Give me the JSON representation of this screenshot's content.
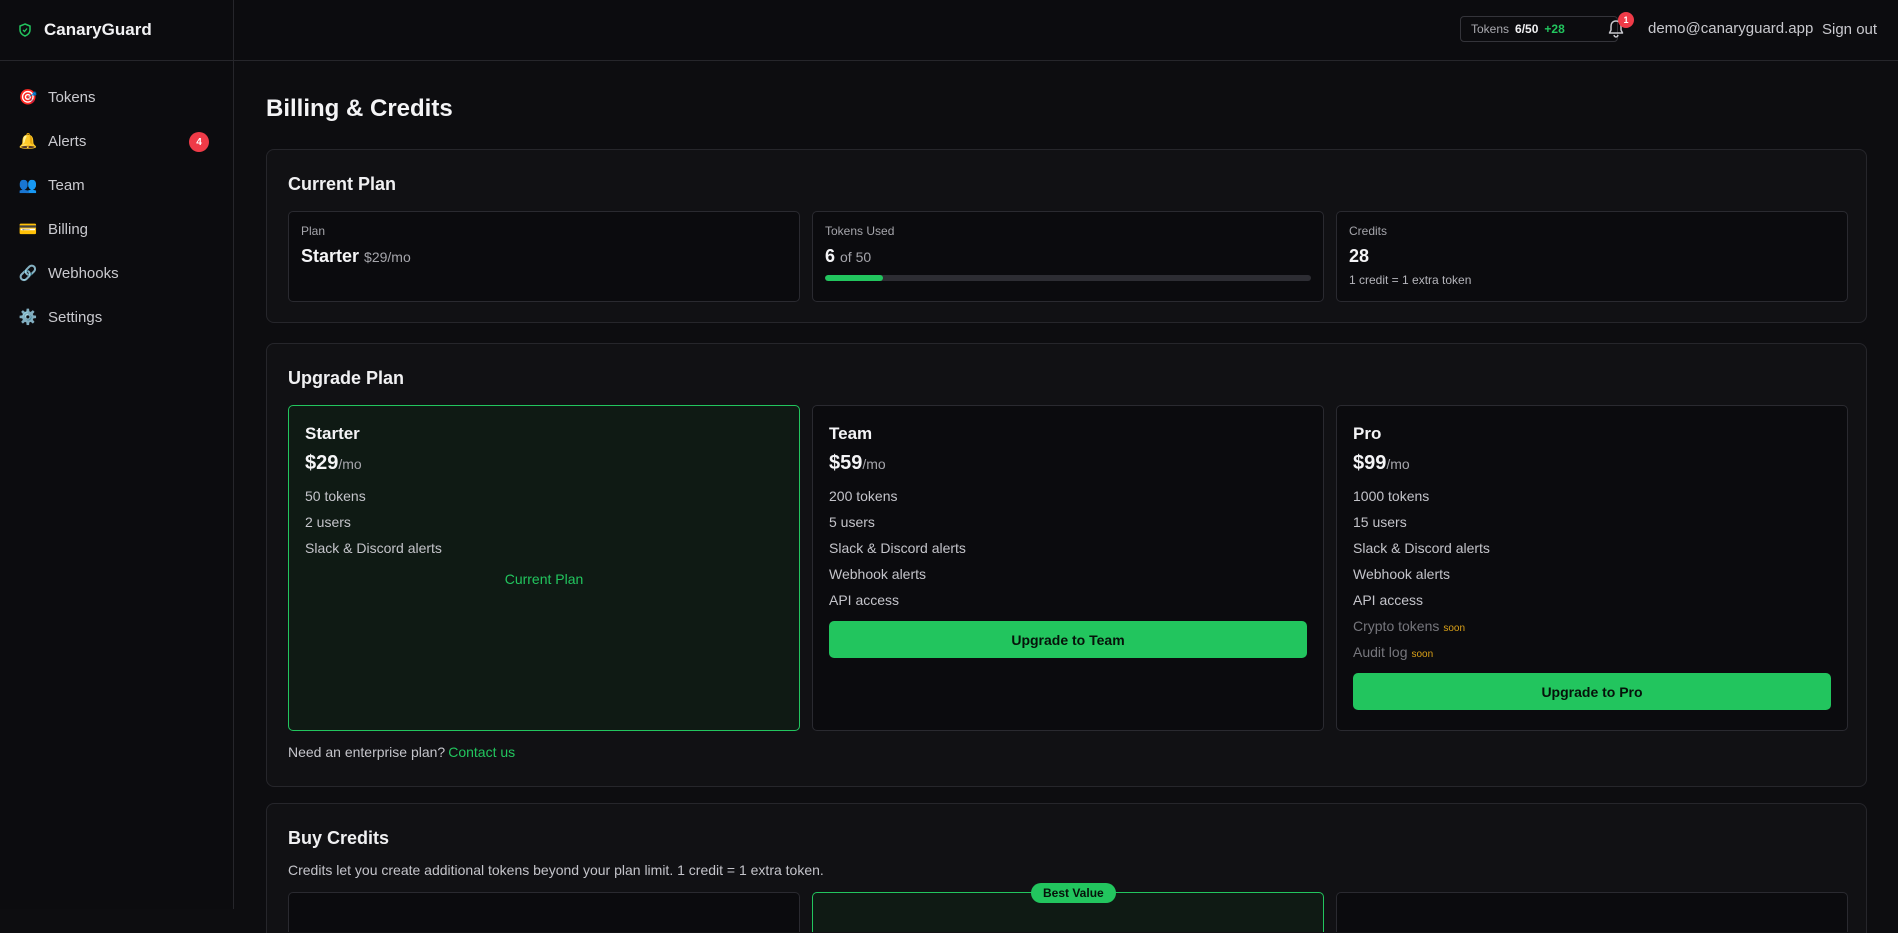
{
  "app": {
    "name": "CanaryGuard"
  },
  "sidebar": {
    "items": [
      {
        "icon": "🎯",
        "label": "Tokens"
      },
      {
        "icon": "🔔",
        "label": "Alerts",
        "badge": "4"
      },
      {
        "icon": "👥",
        "label": "Team"
      },
      {
        "icon": "💳",
        "label": "Billing"
      },
      {
        "icon": "🔗",
        "label": "Webhooks"
      },
      {
        "icon": "⚙️",
        "label": "Settings"
      }
    ]
  },
  "topbar": {
    "tokens_label": "Tokens",
    "tokens_count": "6/50",
    "tokens_extra": "+28",
    "notif_count": "1",
    "email": "demo@canaryguard.app",
    "signout": "Sign out"
  },
  "page": {
    "title": "Billing & Credits"
  },
  "current_plan": {
    "title": "Current Plan",
    "plan": {
      "label": "Plan",
      "value": "Starter",
      "price": "$29/mo"
    },
    "usage": {
      "label": "Tokens Used",
      "value": "6",
      "of": "of 50",
      "progress": 0.12
    },
    "credits": {
      "label": "Credits",
      "value": "28",
      "note": "1 credit = 1 extra token"
    }
  },
  "upgrade": {
    "title": "Upgrade Plan",
    "plans": [
      {
        "name": "Starter",
        "price": "$29",
        "per": "/mo",
        "features": [
          "50 tokens",
          "2 users",
          "Slack & Discord alerts"
        ],
        "current_label": "Current Plan"
      },
      {
        "name": "Team",
        "price": "$59",
        "per": "/mo",
        "features": [
          "200 tokens",
          "5 users",
          "Slack & Discord alerts",
          "Webhook alerts",
          "API access"
        ],
        "button": "Upgrade to Team"
      },
      {
        "name": "Pro",
        "price": "$99",
        "per": "/mo",
        "features": [
          "1000 tokens",
          "15 users",
          "Slack & Discord alerts",
          "Webhook alerts",
          "API access"
        ],
        "soon_features": [
          "Crypto tokens",
          "Audit log"
        ],
        "soon_label": "soon",
        "button": "Upgrade to Pro"
      }
    ],
    "enterprise_text": "Need an enterprise plan?",
    "enterprise_link": "Contact us"
  },
  "buy_credits": {
    "title": "Buy Credits",
    "subtitle": "Credits let you create additional tokens beyond your plan limit. 1 credit = 1 extra token.",
    "best_badge": "Best Value"
  },
  "colors": {
    "accent": "#22c55e",
    "danger": "#ef3b48",
    "warning": "#d9a018"
  }
}
